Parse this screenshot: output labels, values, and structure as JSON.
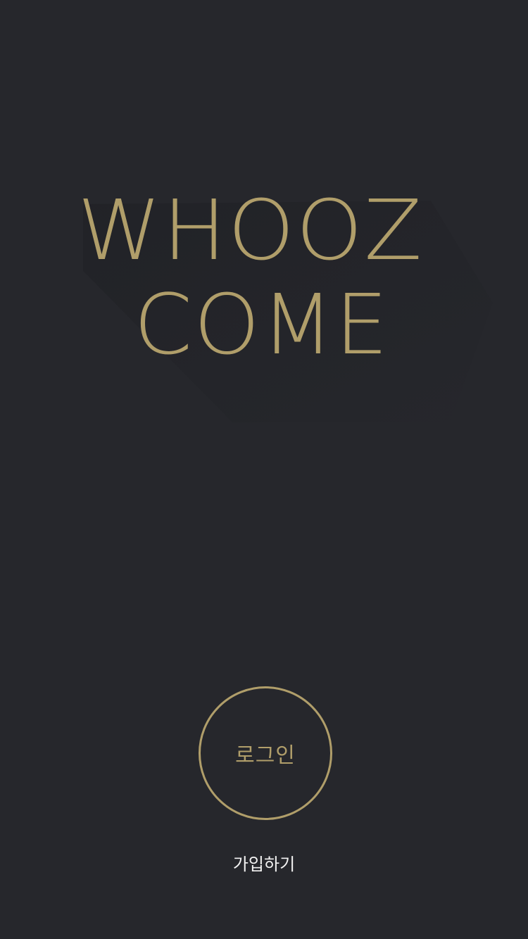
{
  "brand": {
    "line1": "WHOOZ",
    "line2": "COME",
    "color": "#b09e6a"
  },
  "background_color": "#26272c",
  "login": {
    "label": "로그인"
  },
  "signup": {
    "label": "가입하기"
  }
}
